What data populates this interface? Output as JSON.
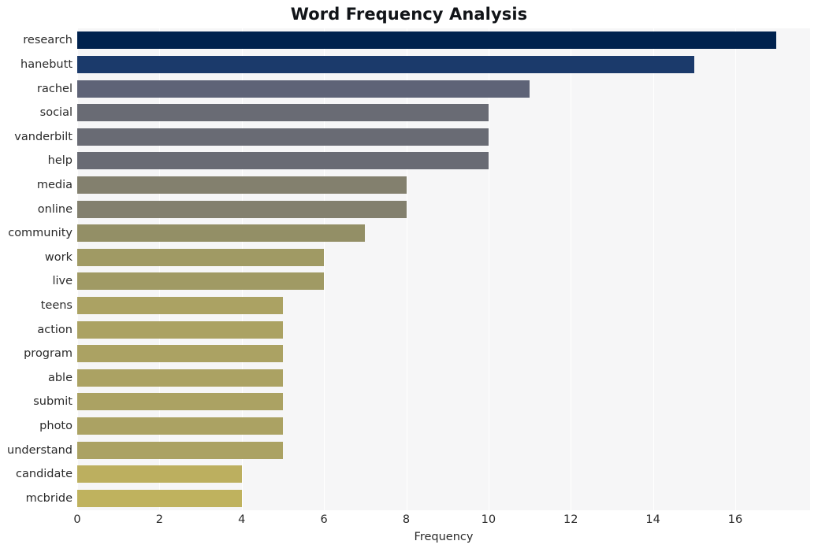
{
  "chart_data": {
    "type": "bar",
    "orientation": "horizontal",
    "title": "Word Frequency Analysis",
    "xlabel": "Frequency",
    "ylabel": "",
    "categories": [
      "research",
      "hanebutt",
      "rachel",
      "social",
      "vanderbilt",
      "help",
      "media",
      "online",
      "community",
      "work",
      "live",
      "teens",
      "action",
      "program",
      "able",
      "submit",
      "photo",
      "understand",
      "candidate",
      "mcbride"
    ],
    "values": [
      17,
      15,
      11,
      10,
      10,
      10,
      8,
      8,
      7,
      6,
      6,
      5,
      5,
      5,
      5,
      5,
      5,
      5,
      4,
      4
    ],
    "bar_colors": [
      "#00224e",
      "#1b3a6b",
      "#5e6377",
      "#696b74",
      "#696b74",
      "#696b74",
      "#83806e",
      "#83806e",
      "#938f66",
      "#a09a64",
      "#a09a64",
      "#aba263",
      "#aba263",
      "#aba263",
      "#aba263",
      "#aba263",
      "#aba263",
      "#aba263",
      "#bcaf5f",
      "#bfb25e"
    ],
    "xticks": [
      0,
      2,
      4,
      6,
      8,
      10,
      12,
      14,
      16
    ],
    "xlim": [
      0,
      17.82
    ],
    "grid": true,
    "grid_axis": "x",
    "legend": null,
    "plot_background": "#f6f6f7",
    "figure_background": "#ffffff",
    "title_color": "#111418",
    "tick_color": "#2a2a2a"
  }
}
